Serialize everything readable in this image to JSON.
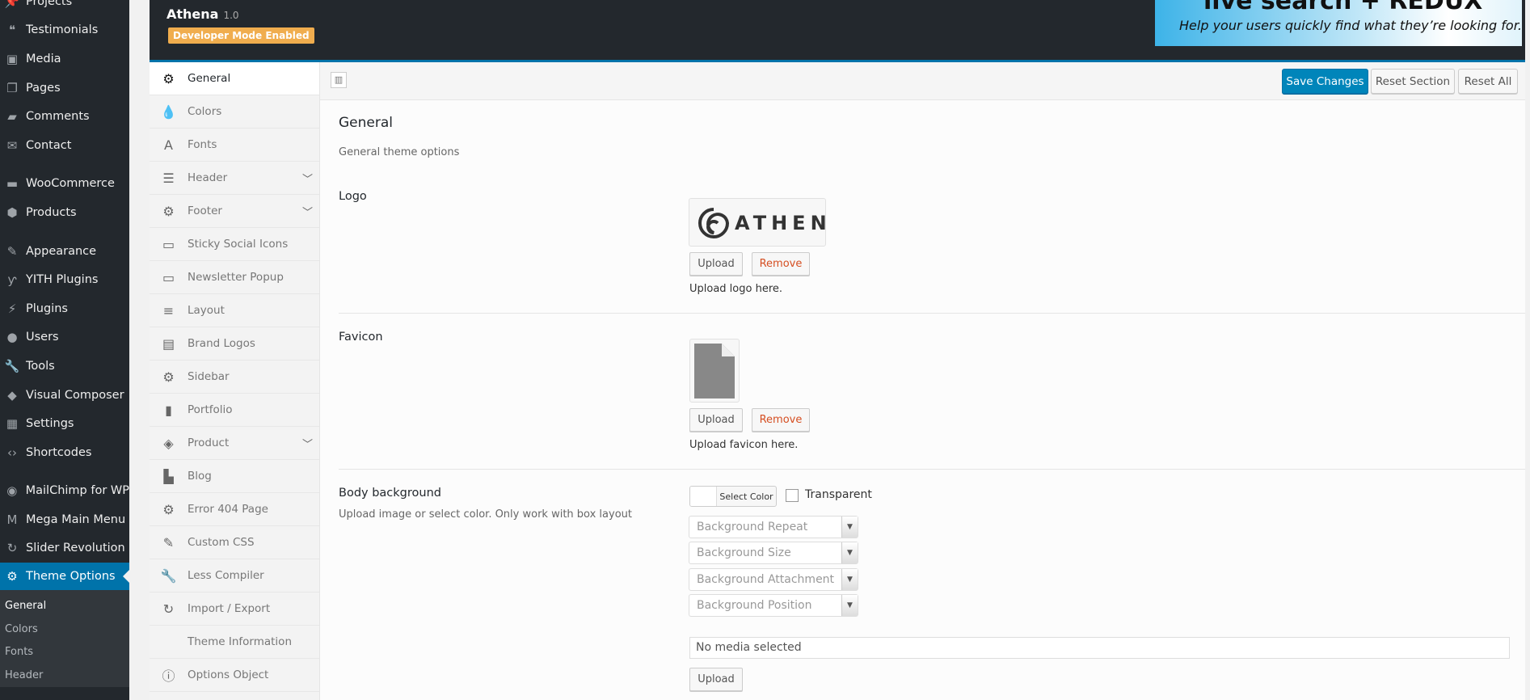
{
  "wp_menu": [
    {
      "label": "Projects",
      "icon": "pin-icon"
    },
    {
      "label": "Testimonials",
      "icon": "quote-icon"
    },
    {
      "label": "Media",
      "icon": "media-icon"
    },
    {
      "label": "Pages",
      "icon": "pages-icon"
    },
    {
      "label": "Comments",
      "icon": "comment-icon"
    },
    {
      "label": "Contact",
      "icon": "mail-icon"
    },
    {
      "label": "WooCommerce",
      "icon": "woo-icon"
    },
    {
      "label": "Products",
      "icon": "box-icon"
    },
    {
      "label": "Appearance",
      "icon": "brush-icon"
    },
    {
      "label": "YITH Plugins",
      "icon": "yith-icon"
    },
    {
      "label": "Plugins",
      "icon": "plug-icon"
    },
    {
      "label": "Users",
      "icon": "user-icon"
    },
    {
      "label": "Tools",
      "icon": "wrench-icon"
    },
    {
      "label": "Visual Composer",
      "icon": "vc-icon"
    },
    {
      "label": "Settings",
      "icon": "settings-icon"
    },
    {
      "label": "Shortcodes",
      "icon": "code-icon"
    },
    {
      "label": "MailChimp for WP",
      "icon": "mailchimp-icon"
    },
    {
      "label": "Mega Main Menu",
      "icon": "mega-icon"
    },
    {
      "label": "Slider Revolution",
      "icon": "refresh-icon"
    },
    {
      "label": "Theme Options",
      "icon": "gear-icon"
    }
  ],
  "wp_submenu": [
    "General",
    "Colors",
    "Fonts",
    "Header"
  ],
  "header": {
    "title": "Athena",
    "version": "1.0",
    "badge": "Developer Mode Enabled",
    "banner_title": "live search + REDUX",
    "banner_tagline": "Help your users quickly find what they’re looking for."
  },
  "nav": [
    {
      "label": "General",
      "icon": "gear-icon"
    },
    {
      "label": "Colors",
      "icon": "drop-icon"
    },
    {
      "label": "Fonts",
      "icon": "font-icon"
    },
    {
      "label": "Header",
      "icon": "header-icon",
      "chevron": true
    },
    {
      "label": "Footer",
      "icon": "gear-icon",
      "chevron": true
    },
    {
      "label": "Sticky Social Icons",
      "icon": "window-icon"
    },
    {
      "label": "Newsletter Popup",
      "icon": "window-icon"
    },
    {
      "label": "Layout",
      "icon": "lines-icon"
    },
    {
      "label": "Brand Logos",
      "icon": "briefcase-icon"
    },
    {
      "label": "Sidebar",
      "icon": "gear-icon"
    },
    {
      "label": "Portfolio",
      "icon": "bookmark-icon"
    },
    {
      "label": "Product",
      "icon": "tags-icon",
      "chevron": true
    },
    {
      "label": "Blog",
      "icon": "file-icon"
    },
    {
      "label": "Error 404 Page",
      "icon": "gear-icon"
    },
    {
      "label": "Custom CSS",
      "icon": "pencil-icon"
    },
    {
      "label": "Less Compiler",
      "icon": "wrench-icon"
    },
    {
      "label": "Import / Export",
      "icon": "refresh-icon"
    },
    {
      "label": "Theme Information",
      "icon": ""
    },
    {
      "label": "Options Object",
      "icon": "info-icon"
    }
  ],
  "toolbar": {
    "save": "Save Changes",
    "reset_section": "Reset Section",
    "reset_all": "Reset All"
  },
  "section": {
    "title": "General",
    "description": "General theme options"
  },
  "fields": {
    "logo": {
      "label": "Logo",
      "logo_text": "ATHENA",
      "upload": "Upload",
      "remove": "Remove",
      "help": "Upload logo here."
    },
    "favicon": {
      "label": "Favicon",
      "upload": "Upload",
      "remove": "Remove",
      "help": "Upload favicon here."
    },
    "body_bg": {
      "label": "Body background",
      "description": "Upload image or select color. Only work with box layout",
      "select_color": "Select Color",
      "transparent": "Transparent",
      "transparent_checked": false,
      "selects": [
        "Background Repeat",
        "Background Size",
        "Background Attachment",
        "Background Position"
      ],
      "media_value": "No media selected",
      "upload": "Upload"
    }
  }
}
